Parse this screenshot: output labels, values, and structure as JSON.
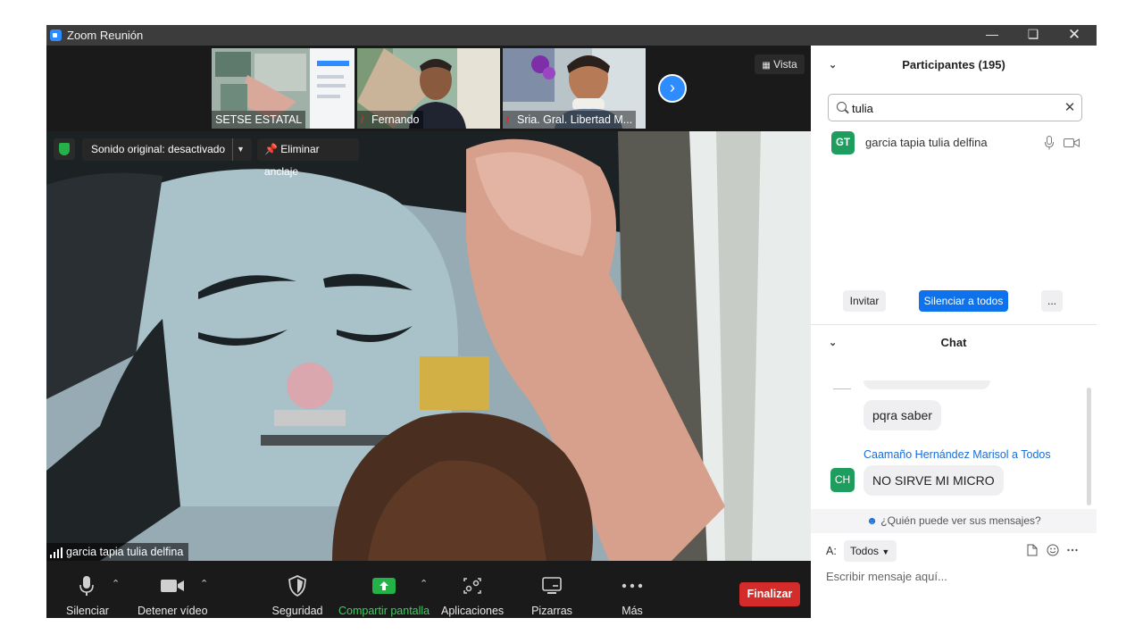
{
  "window": {
    "title": "Zoom Reunión",
    "minimize_icon": "minimize-icon",
    "restore_icon": "restore-icon",
    "close_icon": "close-icon"
  },
  "thumbnails": [
    {
      "label": "SETSE ESTATAL",
      "muted": false
    },
    {
      "label": "Fernando",
      "muted": true
    },
    {
      "label": "Sria. Gral. Libertad M...",
      "muted": true
    }
  ],
  "view_button": "Vista",
  "main_video": {
    "sound_button": "Sonido original: desactivado",
    "unpin_button": "Eliminar anclaje",
    "speaker_name": "garcia  tapia tulia delfina"
  },
  "toolbar": {
    "mute": "Silenciar",
    "video": "Detener vídeo",
    "security": "Seguridad",
    "share": "Compartir pantalla",
    "apps": "Aplicaciones",
    "whiteboards": "Pizarras",
    "more": "Más",
    "end": "Finalizar"
  },
  "participants": {
    "title": "Participantes (195)",
    "search_value": "tulia",
    "items": [
      {
        "initials": "GT",
        "name": "garcia  tapia tulia delfina"
      }
    ],
    "invite": "Invitar",
    "mute_all": "Silenciar a todos",
    "more": "..."
  },
  "chat": {
    "title": "Chat",
    "messages": [
      {
        "text": "pqra saber"
      },
      {
        "sender": "Caamaño Hernández Marisol a Todos",
        "initials": "CH",
        "text": "NO SIRVE MI MICRO"
      }
    ],
    "who_can_see": "¿Quién puede ver sus mensajes?",
    "to_label": "A:",
    "to_value": "Todos",
    "input_placeholder": "Escribir mensaje aquí..."
  },
  "colors": {
    "accent": "#2d8cff",
    "share_green": "#24b248",
    "end_red": "#d42b2b",
    "avatar_green": "#1d9e5e"
  }
}
